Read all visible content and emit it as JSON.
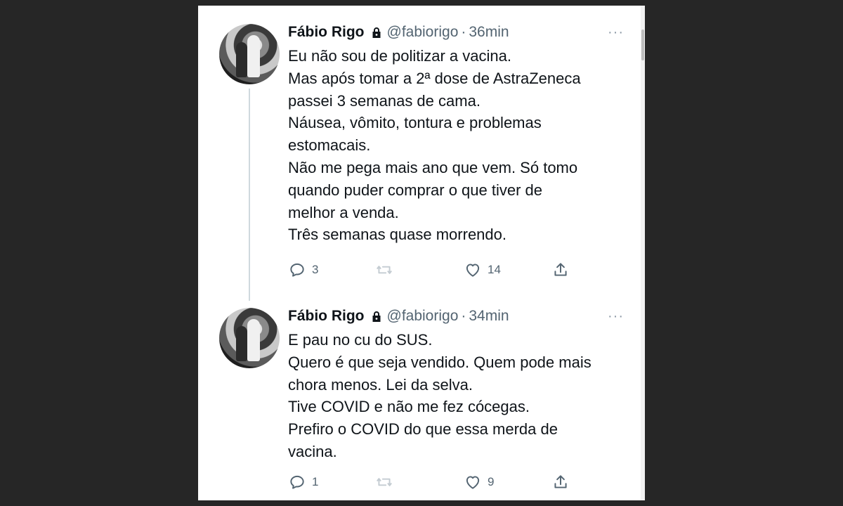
{
  "tweets": [
    {
      "author": "Fábio Rigo",
      "handle": "@fabiorigo",
      "separator": "·",
      "time": "36min",
      "more": "···",
      "lines": [
        "Eu não sou de politizar a vacina.",
        "Mas após tomar a 2ª dose de AstraZeneca",
        "passei 3 semanas de cama.",
        "Náusea, vômito, tontura e problemas",
        "estomacais.",
        "Não me pega mais ano que vem. Só tomo",
        "quando puder comprar o que tiver de",
        "melhor a venda.",
        "Três semanas quase morrendo."
      ],
      "replies": "3",
      "likes": "14"
    },
    {
      "author": "Fábio Rigo",
      "handle": "@fabiorigo",
      "separator": "·",
      "time": "34min",
      "more": "···",
      "lines": [
        "E pau no cu do SUS.",
        "Quero é que seja vendido. Quem pode mais",
        "chora menos. Lei da selva.",
        "Tive COVID e não me fez cócegas.",
        "Prefiro o COVID do que essa merda de",
        "vacina."
      ],
      "replies": "1",
      "likes": "9"
    }
  ],
  "icons": {
    "reply": "reply-icon",
    "retweet": "retweet-icon",
    "like": "like-icon",
    "share": "share-icon",
    "lock": "lock-icon",
    "more": "more-icon"
  },
  "colors": {
    "background": "#262626",
    "card": "#ffffff",
    "text": "#0f1419",
    "muted": "#536471",
    "thread": "#cfd9de"
  }
}
